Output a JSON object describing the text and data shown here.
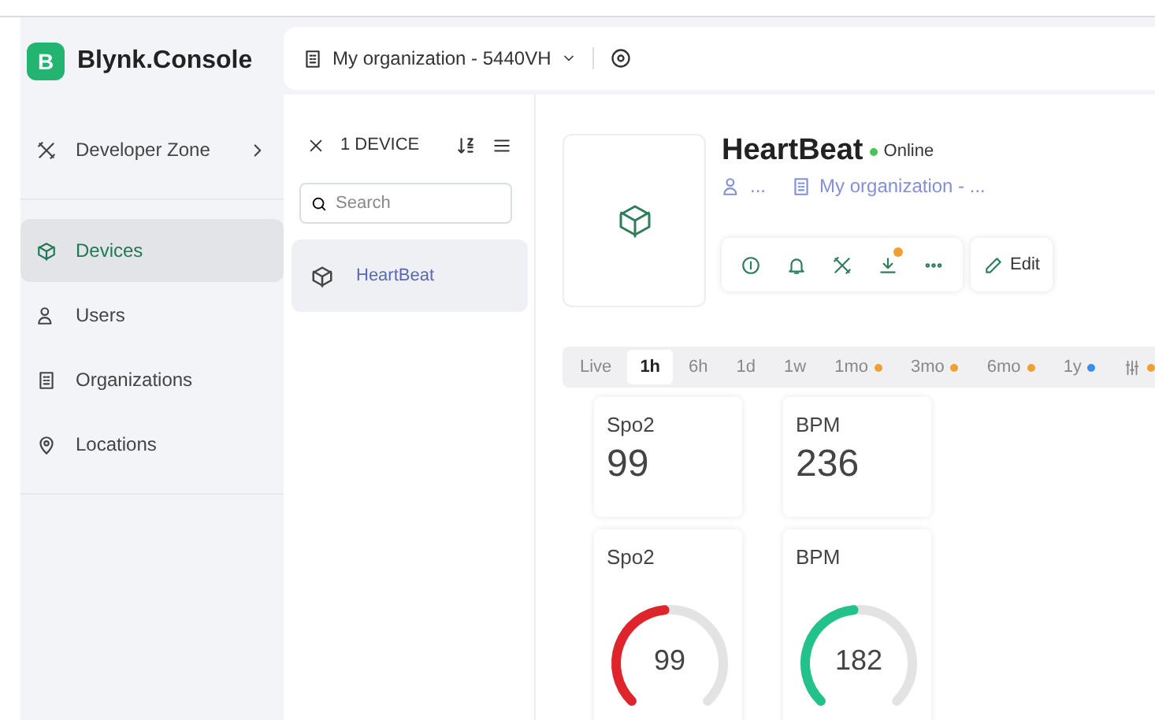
{
  "brand": {
    "logo_letter": "B",
    "name": "Blynk.Console"
  },
  "topbar": {
    "organization": "My organization - 5440VH"
  },
  "sidebar": {
    "items": [
      {
        "label": "Developer Zone",
        "selected": false,
        "has_arrow": true,
        "divider_after": true
      },
      {
        "label": "Devices",
        "selected": true,
        "has_arrow": false,
        "divider_after": false
      },
      {
        "label": "Users",
        "selected": false,
        "has_arrow": false,
        "divider_after": false
      },
      {
        "label": "Organizations",
        "selected": false,
        "has_arrow": false,
        "divider_after": false
      },
      {
        "label": "Locations",
        "selected": false,
        "has_arrow": false,
        "divider_after": true
      }
    ]
  },
  "device_list": {
    "count": "1 DEVICE",
    "search": {
      "placeholder": "Search"
    },
    "items": [
      {
        "name": "HeartBeat",
        "selected": true
      }
    ]
  },
  "device": {
    "name": "HeartBeat",
    "status": "Online",
    "online": true,
    "owner": "...",
    "organization": "My organization - ...",
    "edit": "Edit",
    "download_notice": true
  },
  "time_ranges": [
    {
      "label": "Live",
      "selected": false
    },
    {
      "label": "1h",
      "selected": true
    },
    {
      "label": "6h",
      "selected": false
    },
    {
      "label": "1d",
      "selected": false
    },
    {
      "label": "1w",
      "selected": false
    },
    {
      "label": "1mo",
      "selected": false,
      "color": "#f0a030"
    },
    {
      "label": "3mo",
      "selected": false,
      "color": "#f0a030"
    },
    {
      "label": "6mo",
      "selected": false,
      "color": "#f0a030"
    },
    {
      "label": "1y",
      "selected": false,
      "color": "#3a8ee6"
    },
    {
      "kind": "filter",
      "selected": false,
      "color": "#f0a030"
    }
  ],
  "widgets": [
    {
      "kind": "value",
      "title": "Spo2",
      "value": "99"
    },
    {
      "kind": "value",
      "title": "BPM",
      "value": "236"
    },
    {
      "kind": "gauge",
      "title": "Spo2",
      "value": "99",
      "color": "#e0242c"
    },
    {
      "kind": "gauge",
      "title": "BPM",
      "value": "182",
      "color": "#23c28a"
    }
  ]
}
